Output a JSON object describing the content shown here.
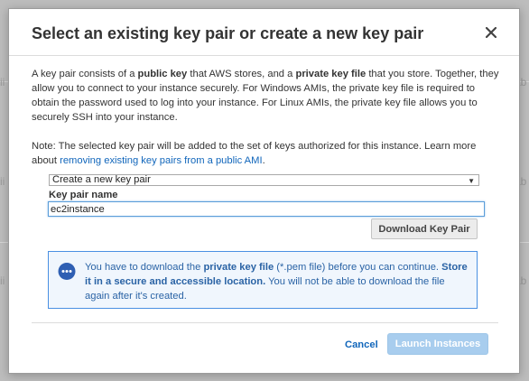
{
  "background": {
    "fragments": [
      "ii",
      "ab",
      "ii",
      "ab",
      "ii",
      "ab"
    ]
  },
  "dialog": {
    "title": "Select an existing key pair or create a new key pair",
    "close_label": "×",
    "description": {
      "p1": "A key pair consists of a ",
      "b1": "public key",
      "p2": " that AWS stores, and a ",
      "b2": "private key file",
      "p3": " that you store. Together, they allow you to connect to your instance securely. For Windows AMIs, the private key file is required to obtain the password used to log into your instance. For Linux AMIs, the private key file allows you to securely SSH into your instance."
    },
    "note": {
      "text": "Note: The selected key pair will be added to the set of keys authorized for this instance. Learn more about ",
      "link": "removing existing key pairs from a public AMI",
      "end": "."
    },
    "select": {
      "value": "Create a new key pair"
    },
    "key_pair_label": "Key pair name",
    "key_pair_value": "ec2instance",
    "download_button": "Download Key Pair",
    "info": {
      "t1": "You have to download the ",
      "b1": "private key file",
      "t2": " (*.pem file) before you can continue. ",
      "b2": "Store it in a secure and accessible location.",
      "t3": " You will not be able to download the file again after it's created."
    },
    "cancel_label": "Cancel",
    "launch_label": "Launch Instances"
  },
  "colors": {
    "link": "#1166bb",
    "info_border": "#4a90e2",
    "info_text": "#2a63a5",
    "launch_disabled": "#a8cdee"
  }
}
